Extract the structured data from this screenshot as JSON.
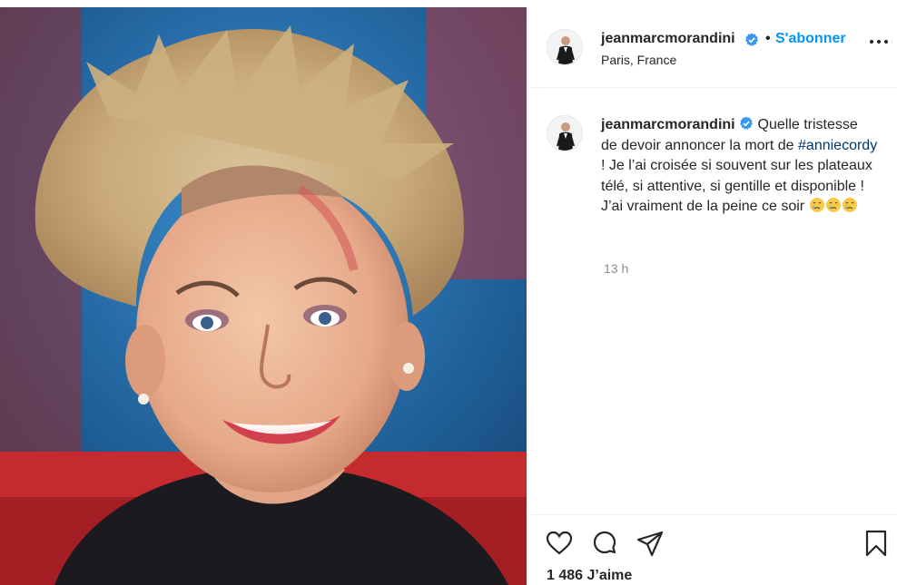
{
  "post": {
    "username": "jeanmarcmorandini",
    "separator": "•",
    "follow_label": "S'abonner",
    "location": "Paris, France",
    "caption": {
      "username": "jeanmarcmorandini",
      "text_before": "Quelle tristesse de devoir annoncer la mort de",
      "hashtag": "#anniecordy",
      "text_after": "! Je l’ai croisée si souvent sur les plateaux télé, si attentive, si gentille et disponible ! J’ai vraiment de la peine ce soir"
    },
    "timestamp": "13 h",
    "likes": "1 486 J’aime"
  },
  "icons": {
    "verified": "verified-badge-icon",
    "more": "more-options-icon",
    "like": "heart-icon",
    "comment": "comment-icon",
    "share": "share-icon",
    "save": "bookmark-icon",
    "emoji": "crying-face-emoji"
  },
  "colors": {
    "accent": "#0095f6",
    "hashtag": "#00376b",
    "muted": "#8e8e8e"
  }
}
